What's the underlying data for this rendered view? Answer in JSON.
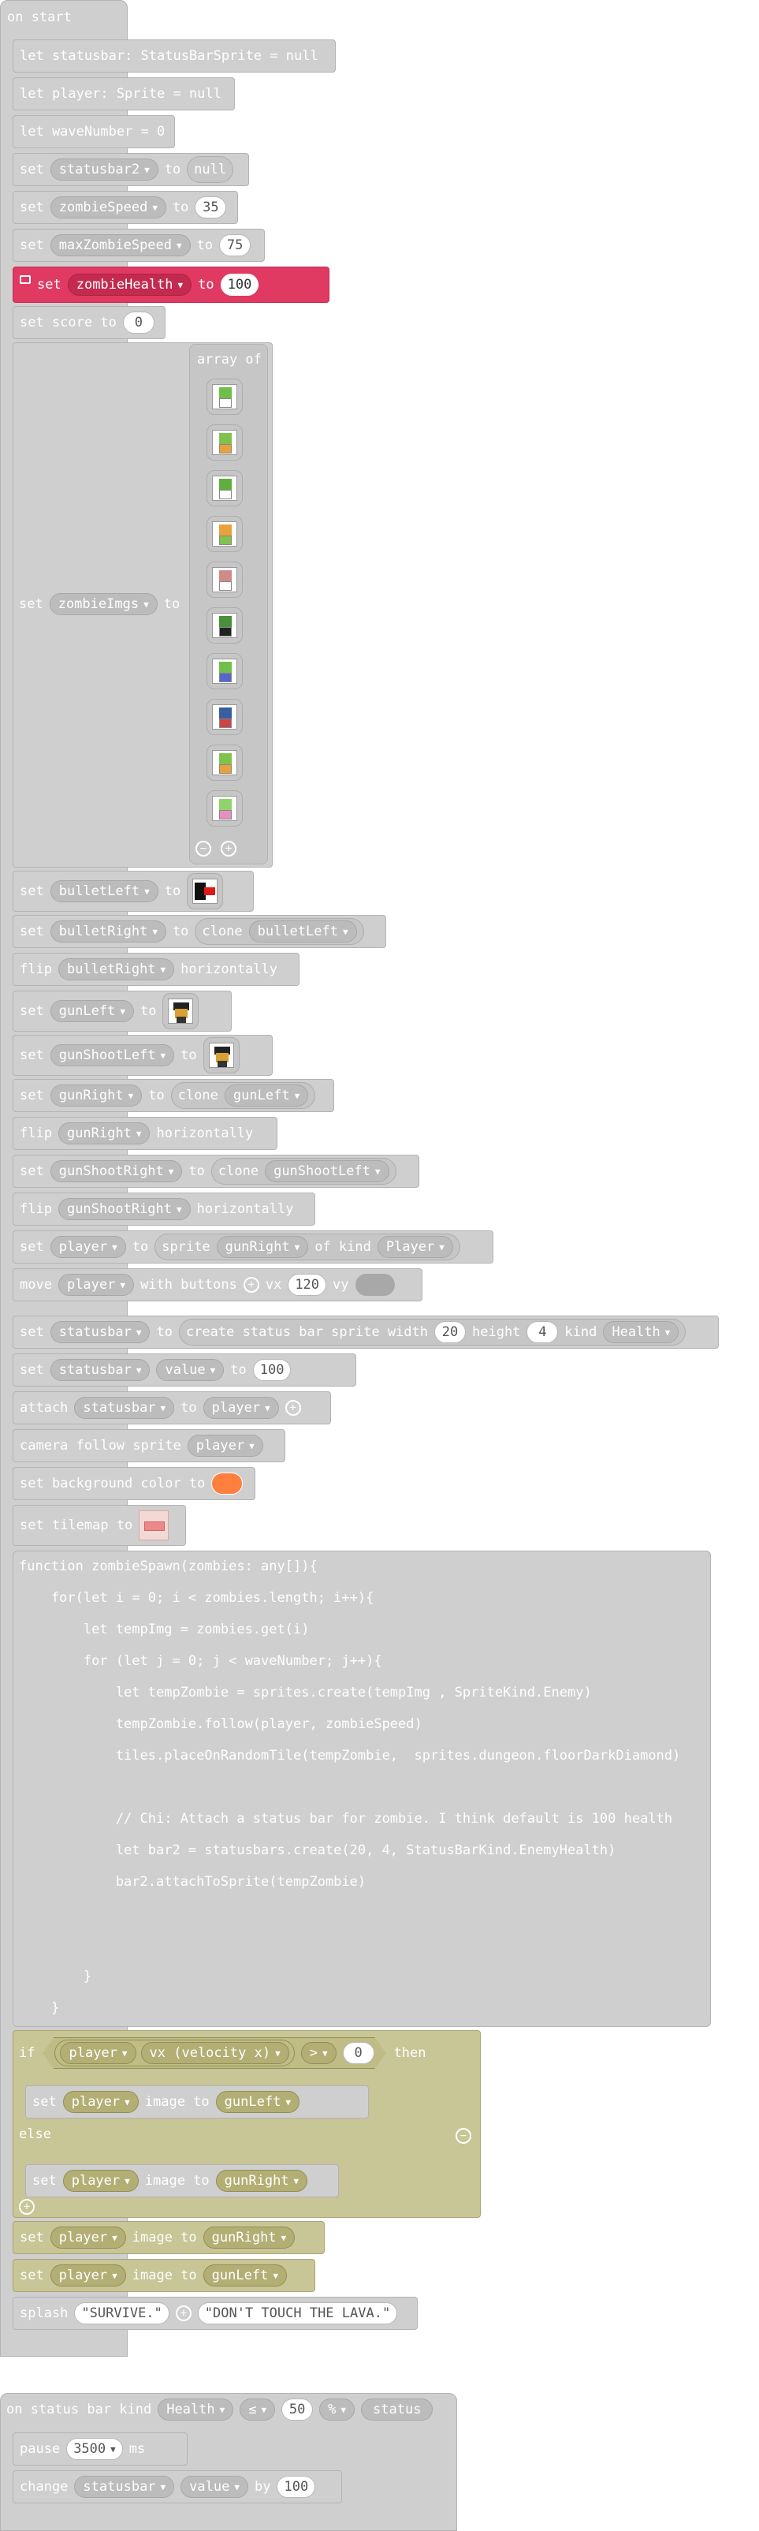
{
  "on_start": {
    "hat_label": "on start",
    "let_statusbar": "let statusbar: StatusBarSprite = null",
    "let_player": "let player: Sprite = null",
    "let_wave": "let waveNumber = 0",
    "set_kw": "set",
    "to_kw": "to",
    "statusbar2": "statusbar2",
    "null_val": "null",
    "zombieSpeed": "zombieSpeed",
    "zombieSpeed_val": "35",
    "maxZombieSpeed": "maxZombieSpeed",
    "maxZombieSpeed_val": "75",
    "zombieHealth": "zombieHealth",
    "zombieHealth_val": "100",
    "set_score": "set score to",
    "score_val": "0",
    "zombieImgs": "zombieImgs",
    "array_of": "array of",
    "bulletLeft": "bulletLeft",
    "bulletRight": "bulletRight",
    "clone_kw": "clone",
    "flip_kw": "flip",
    "horizontally_kw": "horizontally",
    "gunLeft": "gunLeft",
    "gunShootLeft": "gunShootLeft",
    "gunRight": "gunRight",
    "gunShootRight": "gunShootRight",
    "player": "player",
    "sprite_kw": "sprite",
    "of_kind_kw": "of kind",
    "kind_player": "Player",
    "move_kw": "move",
    "with_buttons_kw": "with buttons",
    "vx_kw": "vx",
    "vx_val": "120",
    "vy_kw": "vy",
    "statusbar": "statusbar",
    "create_status_bar": "create status bar sprite width",
    "width_val": "20",
    "height_kw": "height",
    "height_val": "4",
    "kind_kw": "kind",
    "kind_health": "Health",
    "value_kw": "value",
    "value_val": "100",
    "attach_kw": "attach",
    "camera_follow": "camera follow sprite",
    "set_bg": "set background color to",
    "bg_color": "#ff7f3f",
    "set_tilemap": "set tilemap to",
    "code_lines": [
      "function zombieSpawn(zombies: any[]){",
      "    for(let i = 0; i < zombies.length; i++){",
      "        let tempImg = zombies.get(i)",
      "        for (let j = 0; j < waveNumber; j++){",
      "            let tempZombie = sprites.create(tempImg , SpriteKind.Enemy)",
      "            tempZombie.follow(player, zombieSpeed)",
      "            tiles.placeOnRandomTile(tempZombie,  sprites.dungeon.floorDarkDiamond)",
      "",
      "            // Chi: Attach a status bar for zombie. I think default is 100 health",
      "            let bar2 = statusbars.create(20, 4, StatusBarKind.EnemyHealth)",
      "            bar2.attachToSprite(tempZombie)",
      "",
      "",
      "        }",
      "    }",
      "}"
    ],
    "if_kw": "if",
    "vx_velocity": "vx (velocity x)",
    "gt_op": ">",
    "zero_val": "0",
    "then_kw": "then",
    "image_kw": "image to",
    "else_kw": "else",
    "splash_kw": "splash",
    "splash_1": "\"SURVIVE.\"",
    "splash_2": "\"DON'T TOUCH THE LAVA.\""
  },
  "on_status": {
    "hat_label": "on status bar kind",
    "kind": "Health",
    "op": "≤",
    "val": "50",
    "pct": "%",
    "status": "status",
    "pause_kw": "pause",
    "pause_val": "3500",
    "ms_kw": "ms",
    "change_kw": "change",
    "statusbar": "statusbar",
    "value_kw": "value",
    "by_kw": "by",
    "by_val": "100"
  },
  "colors": {
    "block_grey": "#cfcfcf",
    "highlight_red": "#e03a62",
    "if_olive": "#c8c596"
  }
}
